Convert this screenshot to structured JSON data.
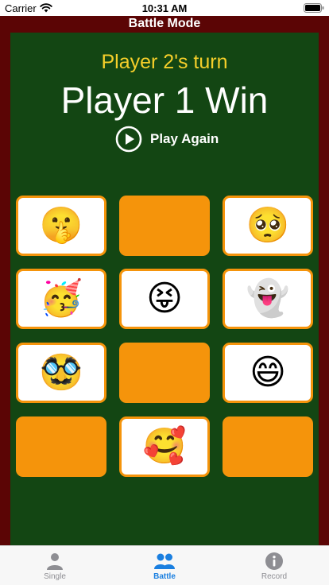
{
  "status_bar": {
    "carrier": "Carrier",
    "time": "10:31 AM",
    "icons": [
      "wifi-icon",
      "battery-icon"
    ]
  },
  "header": {
    "title": "Battle Mode"
  },
  "game": {
    "turn_text": "Player 2's turn",
    "result_text": "Player 1 Win",
    "play_again_label": "Play Again",
    "play_again_icon": "play-circle-icon",
    "cards": [
      {
        "emoji": "🤫",
        "face_up": true
      },
      {
        "emoji": "",
        "face_up": false
      },
      {
        "emoji": "🥺",
        "face_up": true
      },
      {
        "emoji": "🥳",
        "face_up": true
      },
      {
        "emoji": "😝",
        "face_up": true
      },
      {
        "emoji": "👻",
        "face_up": true
      },
      {
        "emoji": "🥸",
        "face_up": true
      },
      {
        "emoji": "",
        "face_up": false
      },
      {
        "emoji": "😄",
        "face_up": true
      },
      {
        "emoji": "",
        "face_up": false
      },
      {
        "emoji": "🥰",
        "face_up": true
      },
      {
        "emoji": "",
        "face_up": false
      }
    ]
  },
  "tab_bar": {
    "tabs": [
      {
        "label": "Single",
        "icon": "person-icon",
        "active": false
      },
      {
        "label": "Battle",
        "icon": "two-people-icon",
        "active": true
      },
      {
        "label": "Record",
        "icon": "info-icon",
        "active": false
      }
    ]
  },
  "colors": {
    "frame": "#5b0505",
    "board": "#134613",
    "card_back": "#f5940b",
    "turn_text": "#f5cf2a",
    "tab_active": "#1a7fe0",
    "tab_inactive": "#8e8e93"
  }
}
